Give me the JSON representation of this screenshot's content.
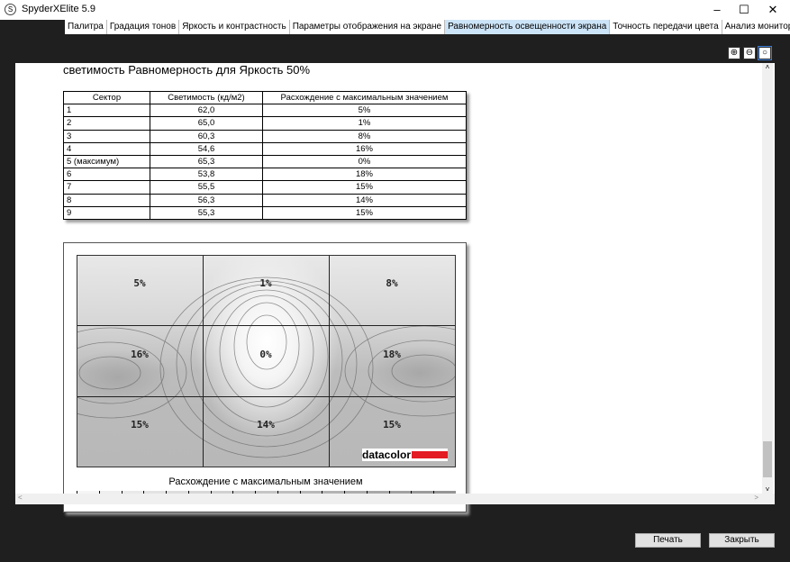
{
  "window": {
    "title": "SpyderXElite 5.9",
    "icon": "S",
    "minimize": "–",
    "maximize": "☐",
    "close": "✕"
  },
  "tabs": [
    {
      "label": "Палитра",
      "active": false
    },
    {
      "label": "Градация тонов",
      "active": false
    },
    {
      "label": "Яркость и контрастность",
      "active": false
    },
    {
      "label": "Параметры отображения на экране",
      "active": false
    },
    {
      "label": "Равномерность освещенности экрана",
      "active": true
    },
    {
      "label": "Точность передачи цвета",
      "active": false
    },
    {
      "label": "Анализ монитора",
      "active": false
    }
  ],
  "zoom_icons": [
    "zoom-in-icon",
    "zoom-out-icon",
    "zoom-fit-icon"
  ],
  "report": {
    "heading": "светимость Равномерность для Яркость 50%",
    "columns": [
      "Сектор",
      "Светимость (кд/м2)",
      "Расхождение с максимальным значением"
    ],
    "rows": [
      [
        "1",
        "62,0",
        "5%"
      ],
      [
        "2",
        "65,0",
        "1%"
      ],
      [
        "3",
        "60,3",
        "8%"
      ],
      [
        "4",
        "54,6",
        "16%"
      ],
      [
        "5 (максимум)",
        "65,3",
        "0%"
      ],
      [
        "6",
        "53,8",
        "18%"
      ],
      [
        "7",
        "55,5",
        "15%"
      ],
      [
        "8",
        "56,3",
        "14%"
      ],
      [
        "9",
        "55,3",
        "15%"
      ]
    ],
    "map": {
      "sectors": [
        "5%",
        "1%",
        "8%",
        "16%",
        "0%",
        "18%",
        "15%",
        "14%",
        "15%"
      ],
      "logo": "datacolor",
      "logo_color": "#e31b23",
      "legend_title": "Расхождение с максимальным значением"
    }
  },
  "buttons": {
    "print": "Печать",
    "close": "Закрыть"
  }
}
